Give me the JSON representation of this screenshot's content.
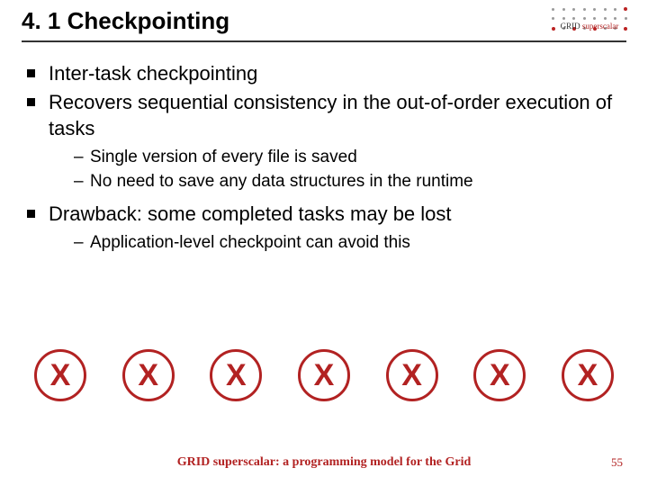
{
  "title": "4. 1 Checkpointing",
  "logo": {
    "grid": "GRID",
    "superscalar": "superscalar"
  },
  "bullets": [
    {
      "text": "Inter-task checkpointing",
      "sub": []
    },
    {
      "text": "Recovers sequential consistency in the out-of-order execution of tasks",
      "sub": [
        "Single version of every file is saved",
        "No need to save any data structures in the runtime"
      ]
    },
    {
      "text": "Drawback: some completed tasks may be lost",
      "sub": [
        "Application-level checkpoint can avoid this"
      ]
    }
  ],
  "x_glyph": "X",
  "x_count": 7,
  "footer": "GRID superscalar: a programming model for the Grid",
  "page": "55"
}
